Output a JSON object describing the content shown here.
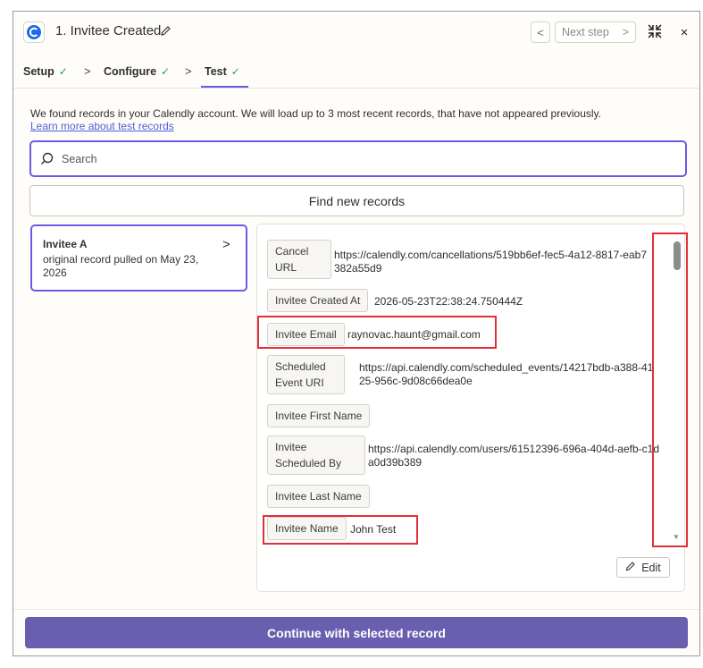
{
  "header": {
    "title": "1. Invitee Created",
    "prev_label": "<",
    "next_label": "Next step",
    "next_chevron": ">",
    "close_label": "×"
  },
  "tabs": [
    {
      "label": "Setup",
      "check": "✓"
    },
    {
      "label": "Configure",
      "check": "✓"
    },
    {
      "label": "Test",
      "check": "✓"
    }
  ],
  "tab_separator": ">",
  "intro": {
    "text": "We found records in your Calendly account. We will load up to 3 most recent records, that have not appeared previously.",
    "link": "Learn more about test records"
  },
  "search": {
    "placeholder": "Search"
  },
  "find_button": "Find new records",
  "record": {
    "title": "Invitee A",
    "subtitle": "original record pulled on May 23, 2026",
    "chevron": ">"
  },
  "fields": [
    {
      "key": "Cancel URL",
      "value": "https://calendly.com/cancellations/519bb6ef-fec5-4a12-8817-eab7382a55d9"
    },
    {
      "key": "Invitee Created At",
      "value": "2026-05-23T22:38:24.750444Z"
    },
    {
      "key": "Invitee Email",
      "value": "raynovac.haunt@gmail.com"
    },
    {
      "key": "Scheduled Event URI",
      "value": "https://api.calendly.com/scheduled_events/14217bdb-a388-4125-956c-9d08c66dea0e"
    },
    {
      "key": "Invitee First Name",
      "value": ""
    },
    {
      "key": "Invitee Scheduled By",
      "value": "https://api.calendly.com/users/61512396-696a-404d-aefb-c1da0d39b389"
    },
    {
      "key": "Invitee Last Name",
      "value": ""
    },
    {
      "key": "Invitee Name",
      "value": "John Test"
    }
  ],
  "edit_button": "Edit",
  "continue_button": "Continue with selected record",
  "colors": {
    "accent": "#695be8",
    "continue": "#695fae",
    "highlight": "#e0303a",
    "check": "#2a9d5c"
  }
}
